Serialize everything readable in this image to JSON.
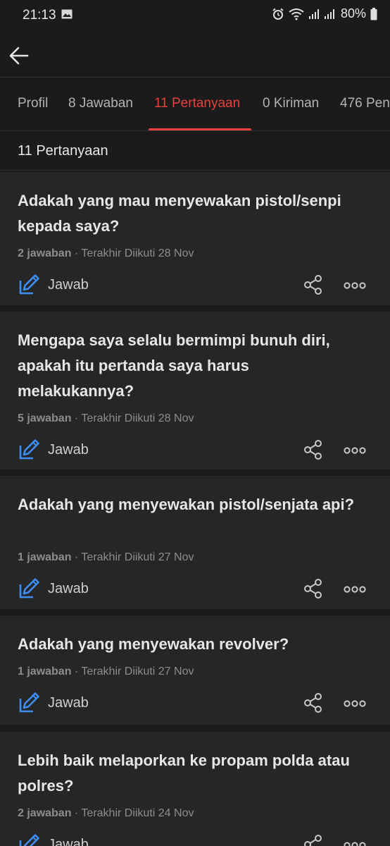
{
  "status_bar": {
    "time": "21:13",
    "battery": "80%"
  },
  "app_bar": {
    "back_icon": "arrow-left-icon"
  },
  "tabs": [
    {
      "label": "Profil",
      "active": false
    },
    {
      "label": "8 Jawaban",
      "active": false
    },
    {
      "label": "11 Pertanyaan",
      "active": true
    },
    {
      "label": "0 Kiriman",
      "active": false
    },
    {
      "label": "476 Pen",
      "active": false
    }
  ],
  "section": {
    "title": "11 Pertanyaan"
  },
  "colors": {
    "accent": "#e8403c",
    "answer_icon": "#3d8ef0",
    "background": "#1b1b1b",
    "card": "#262626"
  },
  "questions": [
    {
      "title": "Adakah yang mau menyewakan pistol/senpi kepada saya?",
      "answers": "2 jawaban",
      "meta": " · Terakhir Diikuti 28 Nov",
      "answer_label": "Jawab"
    },
    {
      "title": "Mengapa saya selalu bermimpi bunuh diri, apakah itu pertanda saya harus melakukannya?",
      "answers": "5 jawaban",
      "meta": " · Terakhir Diikuti 28 Nov",
      "answer_label": "Jawab"
    },
    {
      "title": "Adakah yang menyewakan pistol/senjata api?",
      "answers": "1 jawaban",
      "meta": " · Terakhir Diikuti 27 Nov",
      "answer_label": "Jawab"
    },
    {
      "title": "Adakah yang menyewakan revolver?",
      "answers": "1 jawaban",
      "meta": " · Terakhir Diikuti 27 Nov",
      "answer_label": "Jawab"
    },
    {
      "title": "Lebih baik melaporkan ke propam polda atau polres?",
      "answers": "2 jawaban",
      "meta": " · Terakhir Diikuti 24 Nov",
      "answer_label": "Jawab"
    }
  ]
}
